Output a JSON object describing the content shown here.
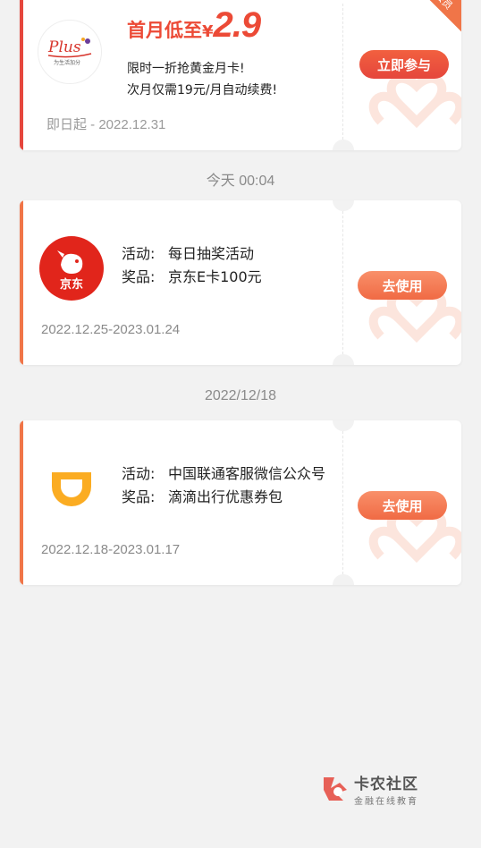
{
  "promo_card": {
    "title": "首月低至",
    "currency": "¥",
    "price": "2.9",
    "line1": "限时一折抢黄金月卡!",
    "line2": "次月仅需19元/月自动续费!",
    "date": "即日起 - 2022.12.31",
    "button": "立即参与",
    "corner": "会员",
    "logo_text": "Plus",
    "logo_sub": "为生活加分"
  },
  "sections": [
    {
      "time": "今天 00:04",
      "card": {
        "activity_label": "活动:",
        "activity": "每日抽奖活动",
        "prize_label": "奖品:",
        "prize": "京东E卡100元",
        "date": "2022.12.25-2023.01.24",
        "button": "去使用",
        "logo_text": "京东"
      }
    },
    {
      "time": "2022/12/18",
      "card": {
        "activity_label": "活动:",
        "activity": "中国联通客服微信公众号",
        "prize_label": "奖品:",
        "prize": "滴滴出行优惠券包",
        "date": "2022.12.18-2023.01.17",
        "button": "去使用"
      }
    }
  ],
  "footer_brand": {
    "name": "卡农社区",
    "tagline": "金融在线教育"
  },
  "colors": {
    "accent_red": "#e5463c",
    "accent_orange": "#f07548",
    "background": "#f2f2f2"
  }
}
